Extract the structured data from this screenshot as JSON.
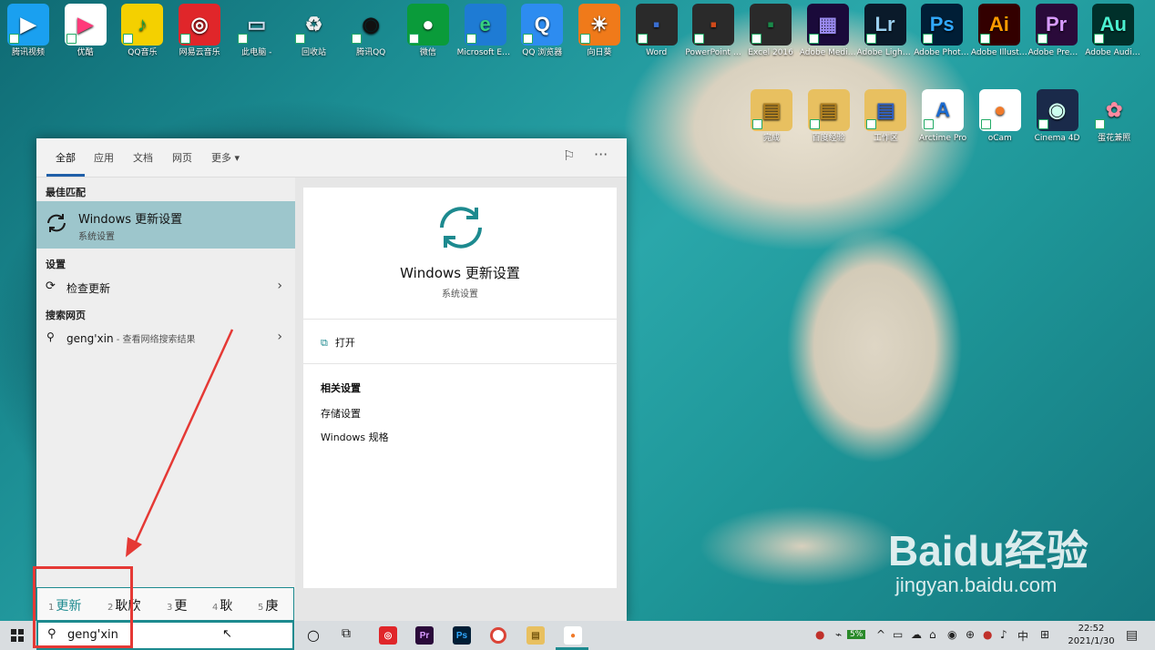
{
  "desktop_icons": [
    {
      "label": "腾讯视频",
      "glyph": "▶",
      "bg": "#1aa0f0",
      "color": "#fff"
    },
    {
      "label": "优酷",
      "glyph": "▶",
      "bg": "#ffffff",
      "color": "#ff3a7a"
    },
    {
      "label": "QQ音乐",
      "glyph": "♪",
      "bg": "#f4d000",
      "color": "#1aa040"
    },
    {
      "label": "网易云音乐",
      "glyph": "◎",
      "bg": "#e0262a",
      "color": "#fff"
    },
    {
      "label": "此电脑 -",
      "glyph": "▭",
      "bg": "transparent",
      "color": "#cde"
    },
    {
      "label": "回收站",
      "glyph": "♻",
      "bg": "transparent",
      "color": "#eee"
    },
    {
      "label": "腾讯QQ",
      "glyph": "◉",
      "bg": "transparent",
      "color": "#111"
    },
    {
      "label": "微信",
      "glyph": "●",
      "bg": "#0a9b3a",
      "color": "#fff"
    },
    {
      "label": "Microsoft Edge",
      "glyph": "e",
      "bg": "#1e7bd4",
      "color": "#35d07f"
    },
    {
      "label": "QQ 浏览器",
      "glyph": "Q",
      "bg": "#2d8cf0",
      "color": "#fff"
    },
    {
      "label": "向日葵",
      "glyph": "☀",
      "bg": "#f07a1a",
      "color": "#fff"
    },
    {
      "label": "Word",
      "glyph": "▪",
      "bg": "#2a2a2a",
      "color": "#3a6ed0"
    },
    {
      "label": "PowerPoint 2016",
      "glyph": "▪",
      "bg": "#2a2a2a",
      "color": "#d04a1a"
    },
    {
      "label": "Excel 2016",
      "glyph": "▪",
      "bg": "#2a2a2a",
      "color": "#1a8a4a"
    },
    {
      "label": "Adobe Media...",
      "glyph": "▦",
      "bg": "#1a0a3a",
      "color": "#9a8af0"
    },
    {
      "label": "Adobe Lightroo...",
      "glyph": "Lr",
      "bg": "#0a1a2a",
      "color": "#9ad0f0"
    },
    {
      "label": "Adobe Photosh...",
      "glyph": "Ps",
      "bg": "#001e36",
      "color": "#31a8ff"
    },
    {
      "label": "Adobe Illustrat...",
      "glyph": "Ai",
      "bg": "#330000",
      "color": "#ff9a00"
    },
    {
      "label": "Adobe Premiere ...",
      "glyph": "Pr",
      "bg": "#2a0a3a",
      "color": "#d89aff"
    },
    {
      "label": "Adobe Auditi...",
      "glyph": "Au",
      "bg": "#00302a",
      "color": "#4af0d0"
    }
  ],
  "desktop_icons_row2": [
    {
      "label": "完成",
      "glyph": "▤",
      "bg": "#e8c060",
      "color": "#b08020"
    },
    {
      "label": "百度经验",
      "glyph": "▤",
      "bg": "#e8c060",
      "color": "#b08020"
    },
    {
      "label": "工作区",
      "glyph": "▤",
      "bg": "#e8c060",
      "color": "#3060c0"
    },
    {
      "label": "Arctime Pro",
      "glyph": "A",
      "bg": "#ffffff",
      "color": "#1a6ad0"
    },
    {
      "label": "oCam",
      "glyph": "●",
      "bg": "#ffffff",
      "color": "#f07a2a"
    },
    {
      "label": "Cinema 4D",
      "glyph": "◉",
      "bg": "#1a2a4a",
      "color": "#cfe"
    },
    {
      "label": "蛋花兼照",
      "glyph": "✿",
      "bg": "transparent",
      "color": "#ff8aa0"
    }
  ],
  "search": {
    "tabs": [
      "全部",
      "应用",
      "文档",
      "网页",
      "更多 ▾"
    ],
    "section_best": "最佳匹配",
    "best_title": "Windows 更新设置",
    "best_subtitle": "系统设置",
    "section_settings": "设置",
    "settings_item": "检查更新",
    "section_web": "搜索网页",
    "web_query": "geng'xin",
    "web_hint": " - 查看网络搜索结果",
    "preview_title": "Windows 更新设置",
    "preview_subtitle": "系统设置",
    "open_label": "打开",
    "related_header": "相关设置",
    "related_1": "存储设置",
    "related_2": "Windows 规格",
    "query_text": "geng'xin"
  },
  "ime": {
    "candidates": [
      {
        "n": "1",
        "t": "更新"
      },
      {
        "n": "2",
        "t": "耿欣"
      },
      {
        "n": "3",
        "t": "更"
      },
      {
        "n": "4",
        "t": "耿"
      },
      {
        "n": "5",
        "t": "庚"
      }
    ]
  },
  "taskbar": {
    "time": "22:52",
    "date": "2021/1/30",
    "lang": "中",
    "battery": "5%"
  },
  "watermark": {
    "brand": "Baidu经验",
    "url": "jingyan.baidu.com"
  },
  "colors": {
    "accent": "#1d8a8f",
    "best_bg": "#9dc6cc",
    "annotation": "#e53935"
  }
}
